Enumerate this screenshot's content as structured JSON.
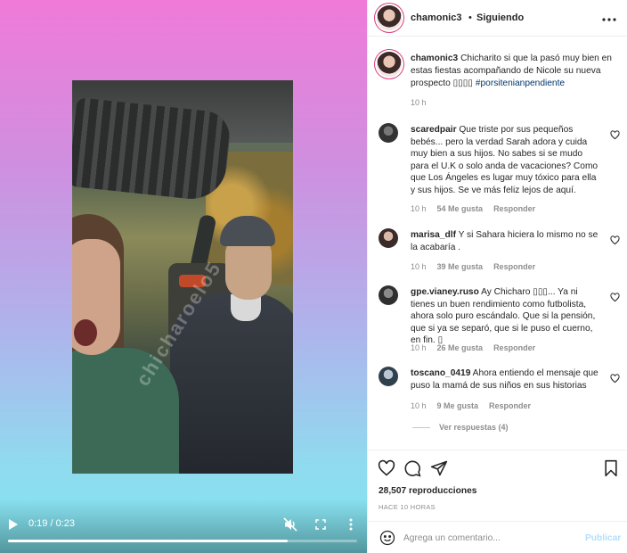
{
  "video": {
    "watermark": "chicharoelo5",
    "time": "0:19 / 0:23",
    "progress": 0.8
  },
  "header": {
    "username": "chamonic3",
    "dot": "•",
    "follow_status": "Siguiendo",
    "more_icon": "more-horizontal-icon"
  },
  "caption": {
    "username": "chamonic3",
    "text": " Chicharito si que la pasó muy bien en estas fiestas acompañando de Nicole su nueva prospecto ▯▯▯▯ ",
    "hashtag": "#porsitenianpendiente",
    "time": "10 h"
  },
  "comments": [
    {
      "username": "scaredpair",
      "text": " Que triste por sus pequeños bebés... pero la verdad Sarah adora y cuida muy bien a sus hijos. No sabes si se mudo para el U.K o solo anda de vacaciones? Como que Los Ángeles es lugar muy tóxico para ella y sus hijos. Se ve más feliz lejos de aquí.",
      "time": "10 h",
      "likes": "54 Me gusta",
      "reply": "Responder"
    },
    {
      "username": "marisa_dlf",
      "text": " Y si Sahara hiciera lo mismo no se la acabaría .",
      "time": "10 h",
      "likes": "39 Me gusta",
      "reply": "Responder"
    },
    {
      "username": "gpe.vianey.ruso",
      "text": " Ay Chicharo ▯▯▯... Ya ni tienes un buen rendimiento como futbolista, ahora solo puro escándalo. Que si la pensión, que si ya se separó, que si le puso el cuerno, en fin. ▯",
      "time": "10 h",
      "likes": "26 Me gusta",
      "reply": "Responder"
    },
    {
      "username": "toscano_0419",
      "text": " Ahora entiendo el mensaje que puso la mamá de sus niños en sus historias",
      "time": "10 h",
      "likes": "9 Me gusta",
      "reply": "Responder"
    }
  ],
  "view_replies": "Ver respuestas (4)",
  "stats": {
    "views": "28,507 reproducciones",
    "ago": "HACE 10 HORAS"
  },
  "comment_box": {
    "placeholder": "Agrega un comentario...",
    "publish": "Publicar"
  },
  "colors": {
    "link": "#00376b",
    "publish_disabled": "#b2dffc",
    "secondary_text": "#8e8e8e"
  }
}
